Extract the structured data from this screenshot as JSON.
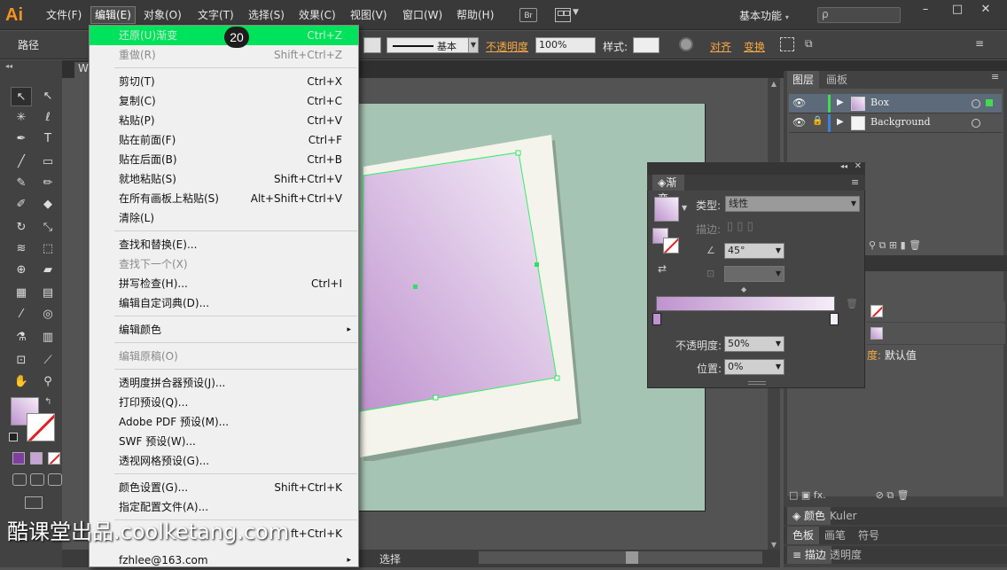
{
  "menubar": {
    "logo": "Ai",
    "items": [
      "文件(F)",
      "编辑(E)",
      "对象(O)",
      "文字(T)",
      "选择(S)",
      "效果(C)",
      "视图(V)",
      "窗口(W)",
      "帮助(H)"
    ],
    "bridge": "Br",
    "workspace": "基本功能",
    "search_placeholder": "ρ",
    "window_buttons": [
      "–",
      "□",
      "✕"
    ]
  },
  "control_bar": {
    "selection_label": "路径",
    "stroke_profile": "基本",
    "opacity_label": "不透明度",
    "opacity_value": "100%",
    "style_label": "样式:",
    "align_label": "对齐",
    "transform_label": "变换"
  },
  "document_tab": "W",
  "status_bar": {
    "tool": "选择"
  },
  "edit_menu": {
    "badge": "20",
    "items": [
      {
        "label": "还原(U)渐变",
        "shortcut": "Ctrl+Z",
        "state": "highlight"
      },
      {
        "label": "重做(R)",
        "shortcut": "Shift+Ctrl+Z",
        "state": "disabled"
      },
      {
        "label": "剪切(T)",
        "shortcut": "Ctrl+X",
        "state": "normal"
      },
      {
        "label": "复制(C)",
        "shortcut": "Ctrl+C",
        "state": "normal"
      },
      {
        "label": "粘贴(P)",
        "shortcut": "Ctrl+V",
        "state": "normal"
      },
      {
        "label": "贴在前面(F)",
        "shortcut": "Ctrl+F",
        "state": "normal"
      },
      {
        "label": "贴在后面(B)",
        "shortcut": "Ctrl+B",
        "state": "normal"
      },
      {
        "label": "就地粘贴(S)",
        "shortcut": "Shift+Ctrl+V",
        "state": "normal"
      },
      {
        "label": "在所有画板上粘贴(S)",
        "shortcut": "Alt+Shift+Ctrl+V",
        "state": "normal"
      },
      {
        "label": "清除(L)",
        "shortcut": "",
        "state": "normal"
      },
      {
        "label": "查找和替换(E)...",
        "shortcut": "",
        "state": "normal"
      },
      {
        "label": "查找下一个(X)",
        "shortcut": "",
        "state": "disabled"
      },
      {
        "label": "拼写检查(H)...",
        "shortcut": "Ctrl+I",
        "state": "normal"
      },
      {
        "label": "编辑自定词典(D)...",
        "shortcut": "",
        "state": "normal"
      },
      {
        "label": "编辑颜色",
        "shortcut": "▸",
        "state": "normal"
      },
      {
        "label": "编辑原稿(O)",
        "shortcut": "",
        "state": "disabled"
      },
      {
        "label": "透明度拼合器预设(J)...",
        "shortcut": "",
        "state": "normal"
      },
      {
        "label": "打印预设(Q)...",
        "shortcut": "",
        "state": "normal"
      },
      {
        "label": "Adobe PDF 预设(M)...",
        "shortcut": "",
        "state": "normal"
      },
      {
        "label": "SWF 预设(W)...",
        "shortcut": "",
        "state": "normal"
      },
      {
        "label": "透视网格预设(G)...",
        "shortcut": "",
        "state": "normal"
      },
      {
        "label": "颜色设置(G)...",
        "shortcut": "Shift+Ctrl+K",
        "state": "normal"
      },
      {
        "label": "指定配置文件(A)...",
        "shortcut": "",
        "state": "normal"
      },
      {
        "label": "",
        "shortcut": "ft+Ctrl+K",
        "state": "normal"
      },
      {
        "label": "fzhlee@163.com",
        "shortcut": "▸",
        "state": "normal"
      }
    ]
  },
  "layers_panel": {
    "tabs": [
      "图层",
      "画板"
    ],
    "layers": [
      "Box",
      "Background"
    ]
  },
  "appearance_panel": {
    "default_label": "默认值",
    "partial_label": "度:"
  },
  "bottom_panels": {
    "row1": [
      "颜色",
      "Kuler"
    ],
    "row2": [
      "色板",
      "画笔",
      "符号"
    ],
    "row3": [
      "描边",
      "透明度"
    ]
  },
  "gradient_panel": {
    "tab": "渐变",
    "type_label": "类型:",
    "type_value": "线性",
    "stroke_label": "描边:",
    "angle_value": "45°",
    "opacity_label": "不透明度:",
    "opacity_value": "50%",
    "location_label": "位置:",
    "location_value": "0%"
  },
  "watermark": "酷课堂出品.coolketang.com",
  "colors": {
    "menu_highlight": "#00e25b",
    "artboard_bg": "#a6c4b3",
    "gradient_start": "#bf93cf",
    "gradient_end": "#f5eef8",
    "accent_orange": "#f7a845"
  }
}
